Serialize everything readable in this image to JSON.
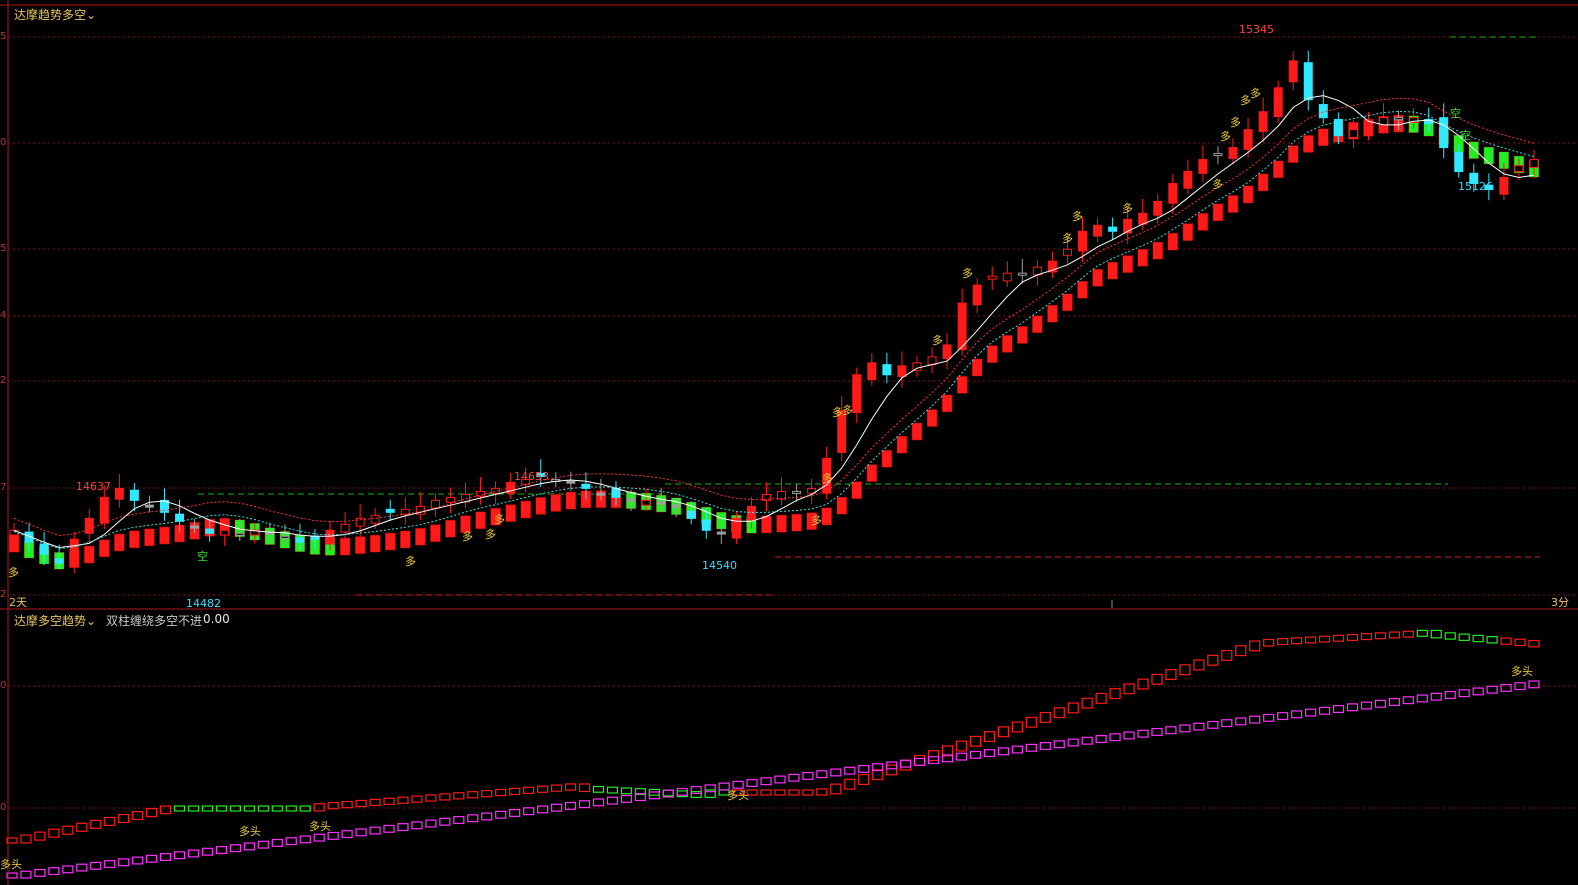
{
  "panel_main": {
    "title": "达摩趋势多空",
    "chevron": "chevron-down-icon",
    "left_scale_label": "2天",
    "right_scale_label": "3分",
    "y_tick_labels": [
      "5",
      "0",
      "5",
      "4",
      "2",
      "7",
      "2"
    ],
    "annotations": {
      "high_left": "14637",
      "high_mid": "14653",
      "high_right": "15345",
      "low_left": "14482",
      "low_mid": "14540",
      "low_right": "15126"
    },
    "signals": {
      "long": "多",
      "short": "空"
    }
  },
  "panel_sub": {
    "title": "达摩多空趋势",
    "chevron": "chevron-down-icon",
    "series_label": "双柱缠绕多空不进",
    "series_value": "0.00",
    "y_tick_labels": [
      "0",
      "0"
    ],
    "signal_label": "多头"
  },
  "colors": {
    "background": "#000000",
    "bull": "#ff1a1a",
    "bear": "#30e8ff",
    "neutral": "#a0a0a0",
    "trend_up": "#ff1a1a",
    "trend_down": "#22ee22",
    "sub_line2": "#ff30ff",
    "signal": "#f0d040",
    "grid": "#8a1010"
  },
  "chart_data": [
    {
      "type": "candlestick",
      "title": "达摩趋势多空",
      "ylim": [
        14430,
        15400
      ],
      "labels": {
        "14637": 14637,
        "14653": 14653,
        "15345": 15345,
        "14482": 14482,
        "14540": 14540,
        "15126": 15126
      },
      "close_path": [
        14560,
        14540,
        14520,
        14505,
        14545,
        14580,
        14615,
        14630,
        14610,
        14600,
        14590,
        14575,
        14565,
        14555,
        14560,
        14555,
        14560,
        14555,
        14550,
        14540,
        14545,
        14560,
        14570,
        14580,
        14585,
        14590,
        14595,
        14600,
        14610,
        14615,
        14620,
        14625,
        14630,
        14640,
        14645,
        14650,
        14645,
        14640,
        14630,
        14620,
        14615,
        14610,
        14610,
        14605,
        14600,
        14580,
        14560,
        14555,
        14580,
        14600,
        14620,
        14625,
        14625,
        14630,
        14680,
        14760,
        14820,
        14840,
        14820,
        14835,
        14840,
        14850,
        14870,
        14940,
        14970,
        14985,
        14990,
        14990,
        15000,
        15010,
        15030,
        15060,
        15070,
        15060,
        15080,
        15090,
        15110,
        15140,
        15160,
        15180,
        15190,
        15200,
        15230,
        15260,
        15300,
        15345,
        15280,
        15250,
        15220,
        15230,
        15240,
        15250,
        15250,
        15250,
        15240,
        15200,
        15160,
        15140,
        15130,
        15150,
        15170,
        15180
      ]
    },
    {
      "type": "line",
      "title": "达摩多空趋势",
      "series": [
        {
          "name": "双柱缠绕多空不进",
          "values": [
            0.0
          ]
        }
      ]
    }
  ]
}
